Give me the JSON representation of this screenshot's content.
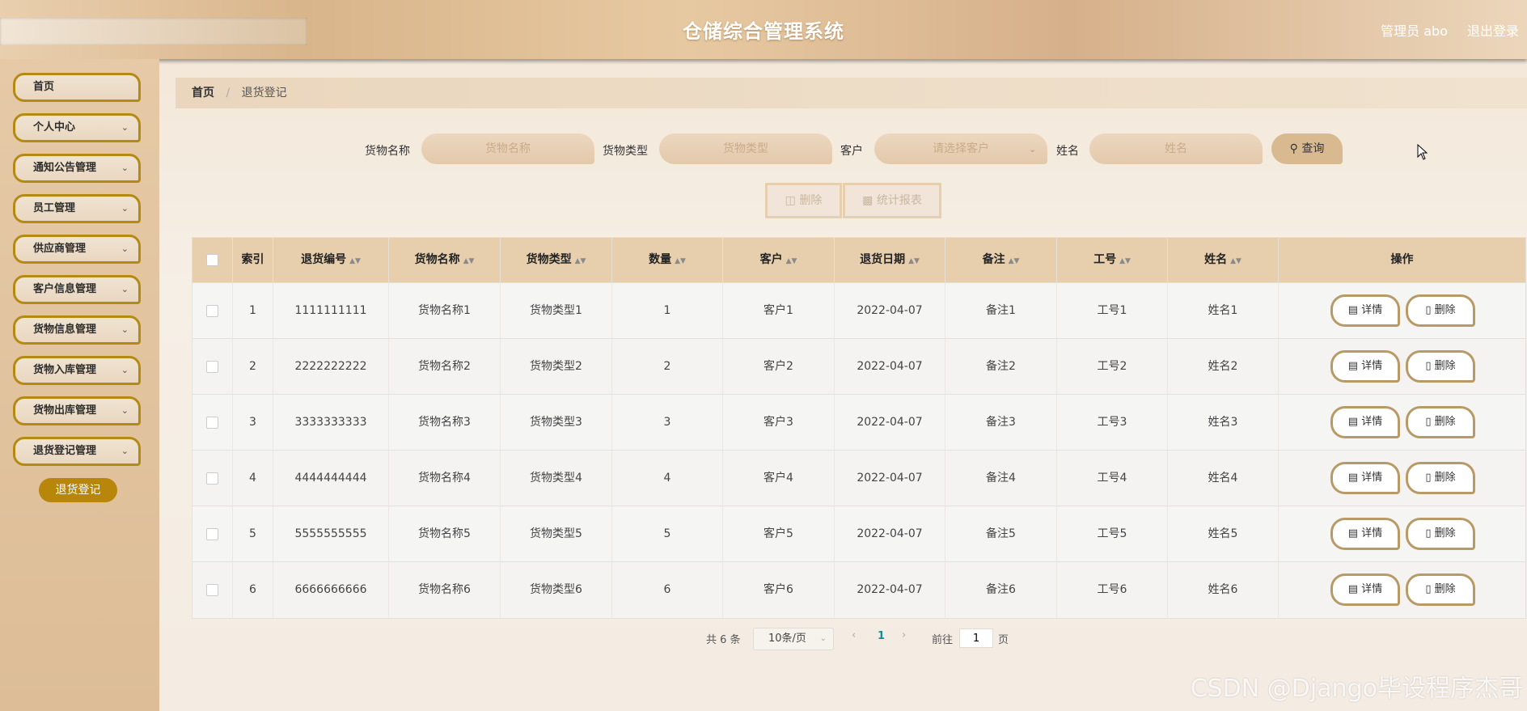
{
  "header": {
    "title": "仓储综合管理系统",
    "user": "管理员 abo",
    "logout": "退出登录"
  },
  "sidebar": {
    "items": [
      {
        "label": "首页",
        "has_children": false
      },
      {
        "label": "个人中心",
        "has_children": true
      },
      {
        "label": "通知公告管理",
        "has_children": true
      },
      {
        "label": "员工管理",
        "has_children": true
      },
      {
        "label": "供应商管理",
        "has_children": true
      },
      {
        "label": "客户信息管理",
        "has_children": true
      },
      {
        "label": "货物信息管理",
        "has_children": true
      },
      {
        "label": "货物入库管理",
        "has_children": true
      },
      {
        "label": "货物出库管理",
        "has_children": true
      },
      {
        "label": "退货登记管理",
        "has_children": true
      }
    ],
    "submenu_active": "退货登记"
  },
  "breadcrumb": {
    "home": "首页",
    "separator": "/",
    "current": "退货登记"
  },
  "search": {
    "goods_name_label": "货物名称",
    "goods_name_placeholder": "货物名称",
    "goods_type_label": "货物类型",
    "goods_type_placeholder": "货物类型",
    "customer_label": "客户",
    "customer_placeholder": "请选择客户",
    "name_label": "姓名",
    "name_placeholder": "姓名",
    "query_button": "查询"
  },
  "actions": {
    "delete_button": "删除",
    "report_button": "统计报表"
  },
  "table": {
    "columns": [
      "索引",
      "退货编号",
      "货物名称",
      "货物类型",
      "数量",
      "客户",
      "退货日期",
      "备注",
      "工号",
      "姓名",
      "操作"
    ],
    "rows": [
      {
        "index": "1",
        "return_no": "1111111111",
        "goods_name": "货物名称1",
        "goods_type": "货物类型1",
        "qty": "1",
        "customer": "客户1",
        "date": "2022-04-07",
        "note": "备注1",
        "emp_no": "工号1",
        "name": "姓名1"
      },
      {
        "index": "2",
        "return_no": "2222222222",
        "goods_name": "货物名称2",
        "goods_type": "货物类型2",
        "qty": "2",
        "customer": "客户2",
        "date": "2022-04-07",
        "note": "备注2",
        "emp_no": "工号2",
        "name": "姓名2"
      },
      {
        "index": "3",
        "return_no": "3333333333",
        "goods_name": "货物名称3",
        "goods_type": "货物类型3",
        "qty": "3",
        "customer": "客户3",
        "date": "2022-04-07",
        "note": "备注3",
        "emp_no": "工号3",
        "name": "姓名3"
      },
      {
        "index": "4",
        "return_no": "4444444444",
        "goods_name": "货物名称4",
        "goods_type": "货物类型4",
        "qty": "4",
        "customer": "客户4",
        "date": "2022-04-07",
        "note": "备注4",
        "emp_no": "工号4",
        "name": "姓名4"
      },
      {
        "index": "5",
        "return_no": "5555555555",
        "goods_name": "货物名称5",
        "goods_type": "货物类型5",
        "qty": "5",
        "customer": "客户5",
        "date": "2022-04-07",
        "note": "备注5",
        "emp_no": "工号5",
        "name": "姓名5"
      },
      {
        "index": "6",
        "return_no": "6666666666",
        "goods_name": "货物名称6",
        "goods_type": "货物类型6",
        "qty": "6",
        "customer": "客户6",
        "date": "2022-04-07",
        "note": "备注6",
        "emp_no": "工号6",
        "name": "姓名6"
      }
    ],
    "row_detail_button": "详情",
    "row_delete_button": "删除"
  },
  "pagination": {
    "total": "共 6 条",
    "page_size": "10条/页",
    "current_page": "1",
    "goto_label": "前往",
    "goto_value": "1",
    "page_suffix": "页"
  },
  "watermark": "CSDN @Django毕设程序杰哥",
  "colors": {
    "accent_gold": "#b58a12",
    "submenu_active_bg": "#b8860b",
    "table_header_bg": "#e7cfae",
    "pagination_active": "#1a8a9a"
  }
}
